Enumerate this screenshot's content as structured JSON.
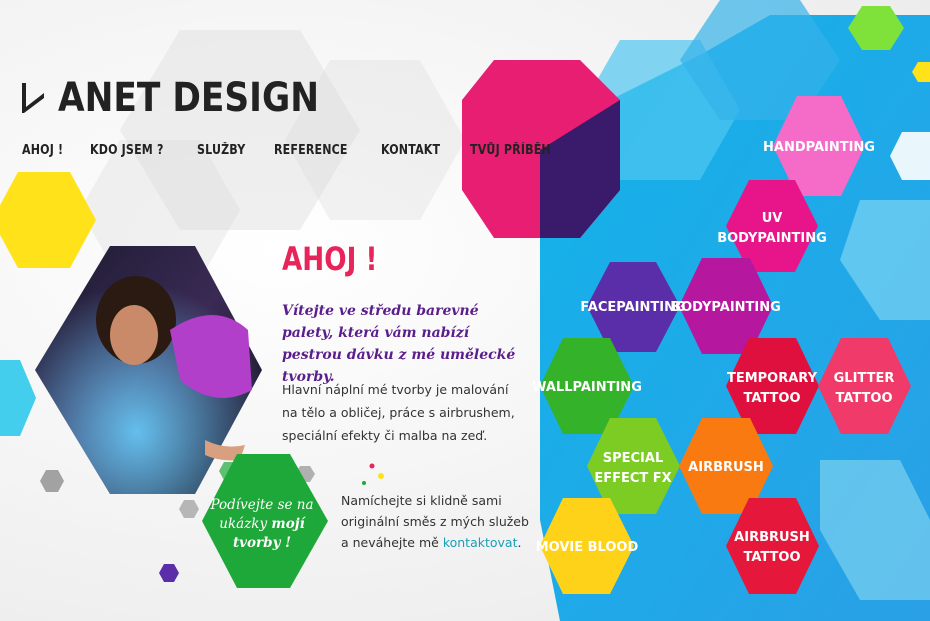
{
  "brand": {
    "name": "ANET DESIGN"
  },
  "nav": [
    {
      "label": "AHOJ !"
    },
    {
      "label": "KDO JSEM ?"
    },
    {
      "label": "SLUŽBY"
    },
    {
      "label": "REFERENCE"
    },
    {
      "label": "KONTAKT"
    },
    {
      "label": "TVŮJ PŘÍBĚH"
    }
  ],
  "intro": {
    "heading": "AHOJ !",
    "lead": "Vítejte ve středu barevné palety, která vám nabízí pestrou dávku z mé umělecké tvorby.",
    "paragraph": "Hlavní náplní mé tvorby je malování na tělo a obličej, práce s airbrushem, speciální efekty či malba na zeď.",
    "cta_line1": "Podívejte se na",
    "cta_line2": "ukázky",
    "cta_bold": "mojí",
    "cta_line3": "tvorby !",
    "invite_text": "Namíchejte si klidně sami originální směs z mých služeb a neváhejte mě",
    "invite_link": "kontaktovat",
    "invite_end": "."
  },
  "services": {
    "handpainting": [
      "HANDPAINTING"
    ],
    "uv": [
      "UV",
      "BODYPAINTING"
    ],
    "facepainting": [
      "FACEPAINTING"
    ],
    "bodypainting": [
      "BODYPAINTING"
    ],
    "wallpainting": [
      "WALLPAINTING"
    ],
    "temporary": [
      "TEMPORARY",
      "TATTOO"
    ],
    "glitter": [
      "GLITTER",
      "TATTOO"
    ],
    "special": [
      "SPECIAL",
      "EFFECT FX"
    ],
    "airbrush": [
      "AIRBRUSH"
    ],
    "movie": [
      "MOVIE BLOOD"
    ],
    "airbrush_tattoo": [
      "AIRBRUSH",
      "TATTOO"
    ]
  },
  "colors": {
    "accent": "#e8255a",
    "purple": "#5a1e8c",
    "link": "#1a9fb8",
    "cyan": "#19b8e8",
    "green": "#1fa83a"
  }
}
